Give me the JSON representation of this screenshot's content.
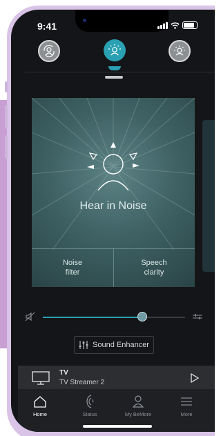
{
  "status_bar": {
    "time": "9:41"
  },
  "programs": [
    {
      "icon": "auto-program-icon",
      "active": false
    },
    {
      "icon": "hear-in-noise-icon",
      "active": true
    },
    {
      "icon": "hearing-program-icon",
      "active": false
    }
  ],
  "program_card": {
    "title": "Hear in Noise",
    "buttons": [
      {
        "label": "Noise\nfilter"
      },
      {
        "label": "Speech\nclarity"
      }
    ]
  },
  "volume": {
    "level": 0.7
  },
  "sound_enhancer": {
    "label": "Sound Enhancer"
  },
  "streamer": {
    "title": "TV",
    "subtitle": "TV Streamer 2"
  },
  "tabbar": {
    "items": [
      {
        "label": "Home",
        "icon": "home-icon",
        "active": true
      },
      {
        "label": "Status",
        "icon": "status-icon",
        "active": false
      },
      {
        "label": "My BeMore",
        "icon": "user-icon",
        "active": false
      },
      {
        "label": "More",
        "icon": "menu-icon",
        "active": false
      }
    ]
  },
  "colors": {
    "accent": "#2aa1b3",
    "background": "#141518",
    "card": "#3f6265"
  }
}
